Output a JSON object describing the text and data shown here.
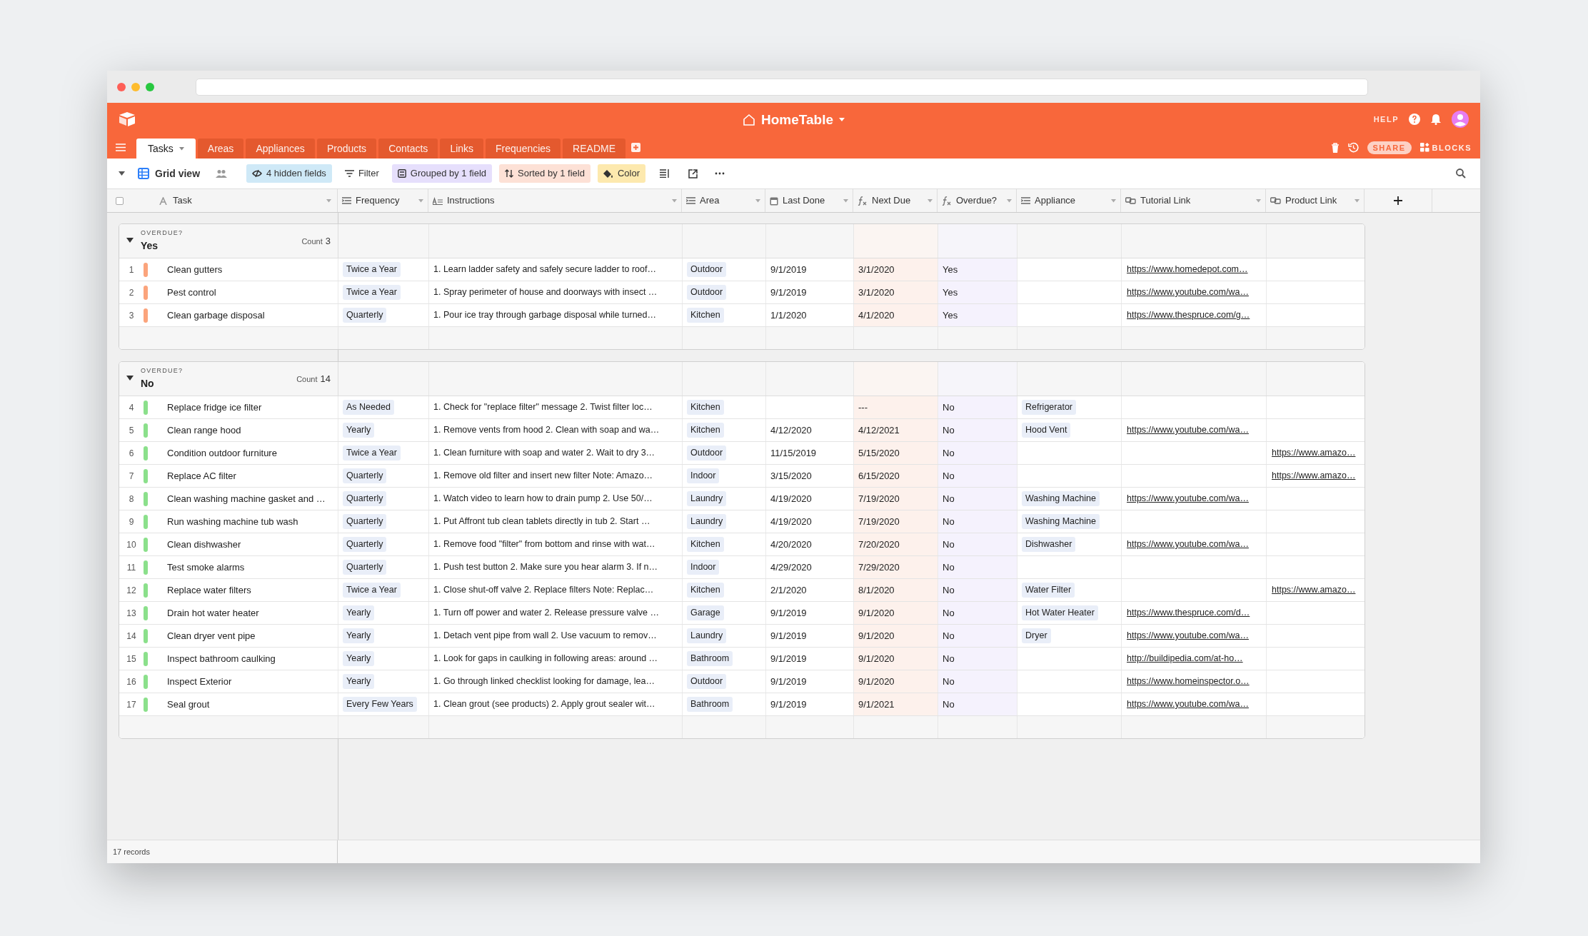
{
  "app": {
    "title": "HomeTable",
    "help": "HELP",
    "share": "SHARE",
    "blocks": "BLOCKS"
  },
  "tabs": [
    {
      "label": "Tasks",
      "selected": true
    },
    {
      "label": "Areas",
      "selected": false
    },
    {
      "label": "Appliances",
      "selected": false
    },
    {
      "label": "Products",
      "selected": false
    },
    {
      "label": "Contacts",
      "selected": false
    },
    {
      "label": "Links",
      "selected": false
    },
    {
      "label": "Frequencies",
      "selected": false
    },
    {
      "label": "README",
      "selected": false
    }
  ],
  "toolbar": {
    "view_name": "Grid view",
    "buttons": [
      {
        "kind": "hide",
        "label": "4 hidden fields"
      },
      {
        "kind": "filter",
        "label": "Filter"
      },
      {
        "kind": "group",
        "label": "Grouped by 1 field"
      },
      {
        "kind": "sort",
        "label": "Sorted by 1 field"
      },
      {
        "kind": "color",
        "label": "Color"
      }
    ]
  },
  "select_all": {
    "checked": false
  },
  "columns": [
    {
      "kind": "text",
      "label": "Task"
    },
    {
      "kind": "select",
      "label": "Frequency"
    },
    {
      "kind": "longtext",
      "label": "Instructions"
    },
    {
      "kind": "select",
      "label": "Area"
    },
    {
      "kind": "date",
      "label": "Last Done"
    },
    {
      "kind": "formula",
      "label": "Next Due"
    },
    {
      "kind": "formula",
      "label": "Overdue?"
    },
    {
      "kind": "select",
      "label": "Appliance"
    },
    {
      "kind": "link",
      "label": "Tutorial Link"
    },
    {
      "kind": "link",
      "label": "Product Link"
    }
  ],
  "groups": [
    {
      "field": "OVERDUE?",
      "value": "Yes",
      "count_label": "Count",
      "count": "3",
      "color": "#fba47c",
      "expanded": true,
      "rows": [
        {
          "number": "1",
          "task": "Clean gutters",
          "frequency": "Twice a Year",
          "instructions": "1. Learn ladder safety and safely secure ladder to roof…",
          "area": "Outdoor",
          "last_done": "9/1/2019",
          "next_due": "3/1/2020",
          "overdue": "Yes",
          "tutorial_link": "https://www.homedepot.com…"
        },
        {
          "number": "2",
          "task": "Pest control",
          "frequency": "Twice a Year",
          "instructions": "1. Spray perimeter of house and doorways with insect …",
          "area": "Outdoor",
          "last_done": "9/1/2019",
          "next_due": "3/1/2020",
          "overdue": "Yes",
          "tutorial_link": "https://www.youtube.com/wa…"
        },
        {
          "number": "3",
          "task": "Clean garbage disposal",
          "frequency": "Quarterly",
          "instructions": "1. Pour ice tray through garbage disposal while turned…",
          "area": "Kitchen",
          "last_done": "1/1/2020",
          "next_due": "4/1/2020",
          "overdue": "Yes",
          "tutorial_link": "https://www.thespruce.com/g…"
        }
      ]
    },
    {
      "field": "OVERDUE?",
      "value": "No",
      "count_label": "Count",
      "count": "14",
      "color": "#8be08b",
      "expanded": true,
      "rows": [
        {
          "number": "4",
          "task": "Replace fridge ice filter",
          "frequency": "As Needed",
          "instructions": "1. Check for \"replace filter\" message 2. Twist filter loc…",
          "area": "Kitchen",
          "next_due": "---",
          "overdue": "No",
          "appliance": "Refrigerator"
        },
        {
          "number": "5",
          "task": "Clean range hood",
          "frequency": "Yearly",
          "instructions": "1. Remove vents from hood 2. Clean with soap and wa…",
          "area": "Kitchen",
          "last_done": "4/12/2020",
          "next_due": "4/12/2021",
          "overdue": "No",
          "appliance": "Hood Vent",
          "tutorial_link": "https://www.youtube.com/wa…"
        },
        {
          "number": "6",
          "task": "Condition outdoor furniture",
          "frequency": "Twice a Year",
          "instructions": "1. Clean furniture with soap and water 2. Wait to dry 3…",
          "area": "Outdoor",
          "last_done": "11/15/2019",
          "next_due": "5/15/2020",
          "overdue": "No",
          "product_link": "https://www.amazo…"
        },
        {
          "number": "7",
          "task": "Replace AC filter",
          "frequency": "Quarterly",
          "instructions": "1. Remove old filter and insert new filter Note: Amazo…",
          "area": "Indoor",
          "last_done": "3/15/2020",
          "next_due": "6/15/2020",
          "overdue": "No",
          "product_link": "https://www.amazo…"
        },
        {
          "number": "8",
          "task": "Clean washing machine gasket and …",
          "frequency": "Quarterly",
          "instructions": "1. Watch video to learn how to drain pump 2. Use 50/…",
          "area": "Laundry",
          "last_done": "4/19/2020",
          "next_due": "7/19/2020",
          "overdue": "No",
          "appliance": "Washing Machine",
          "tutorial_link": "https://www.youtube.com/wa…"
        },
        {
          "number": "9",
          "task": "Run washing machine tub wash",
          "frequency": "Quarterly",
          "instructions": "1. Put Affront tub clean tablets directly in tub 2. Start …",
          "area": "Laundry",
          "last_done": "4/19/2020",
          "next_due": "7/19/2020",
          "overdue": "No",
          "appliance": "Washing Machine"
        },
        {
          "number": "10",
          "task": "Clean dishwasher",
          "frequency": "Quarterly",
          "instructions": "1. Remove food \"filter\" from bottom and rinse with wat…",
          "area": "Kitchen",
          "last_done": "4/20/2020",
          "next_due": "7/20/2020",
          "overdue": "No",
          "appliance": "Dishwasher",
          "tutorial_link": "https://www.youtube.com/wa…"
        },
        {
          "number": "11",
          "task": "Test smoke alarms",
          "frequency": "Quarterly",
          "instructions": "1. Push test button 2. Make sure you hear alarm 3. If n…",
          "area": "Indoor",
          "last_done": "4/29/2020",
          "next_due": "7/29/2020",
          "overdue": "No"
        },
        {
          "number": "12",
          "task": "Replace water filters",
          "frequency": "Twice a Year",
          "instructions": "1. Close shut-off valve 2. Replace filters Note: Replac…",
          "area": "Kitchen",
          "last_done": "2/1/2020",
          "next_due": "8/1/2020",
          "overdue": "No",
          "appliance": "Water Filter",
          "product_link": "https://www.amazo…"
        },
        {
          "number": "13",
          "task": "Drain hot water heater",
          "frequency": "Yearly",
          "instructions": "1. Turn off power and water 2. Release pressure valve …",
          "area": "Garage",
          "last_done": "9/1/2019",
          "next_due": "9/1/2020",
          "overdue": "No",
          "appliance": "Hot Water Heater",
          "tutorial_link": "https://www.thespruce.com/d…"
        },
        {
          "number": "14",
          "task": "Clean dryer vent pipe",
          "frequency": "Yearly",
          "instructions": "1. Detach vent pipe from wall 2. Use vacuum to remov…",
          "area": "Laundry",
          "last_done": "9/1/2019",
          "next_due": "9/1/2020",
          "overdue": "No",
          "appliance": "Dryer",
          "tutorial_link": "https://www.youtube.com/wa…"
        },
        {
          "number": "15",
          "task": "Inspect bathroom caulking",
          "frequency": "Yearly",
          "instructions": "1. Look for gaps in caulking in following areas: around …",
          "area": "Bathroom",
          "last_done": "9/1/2019",
          "next_due": "9/1/2020",
          "overdue": "No",
          "tutorial_link": "http://buildipedia.com/at-ho…"
        },
        {
          "number": "16",
          "task": "Inspect Exterior",
          "frequency": "Yearly",
          "instructions": "1. Go through linked checklist looking for damage, lea…",
          "area": "Outdoor",
          "last_done": "9/1/2019",
          "next_due": "9/1/2020",
          "overdue": "No",
          "tutorial_link": "https://www.homeinspector.o…"
        },
        {
          "number": "17",
          "task": "Seal grout",
          "frequency": "Every Few Years",
          "instructions": "1. Clean grout (see products) 2. Apply grout sealer wit…",
          "area": "Bathroom",
          "last_done": "9/1/2019",
          "next_due": "9/1/2021",
          "overdue": "No",
          "tutorial_link": "https://www.youtube.com/wa…"
        }
      ]
    }
  ],
  "footer": {
    "record_count": "17 records"
  }
}
